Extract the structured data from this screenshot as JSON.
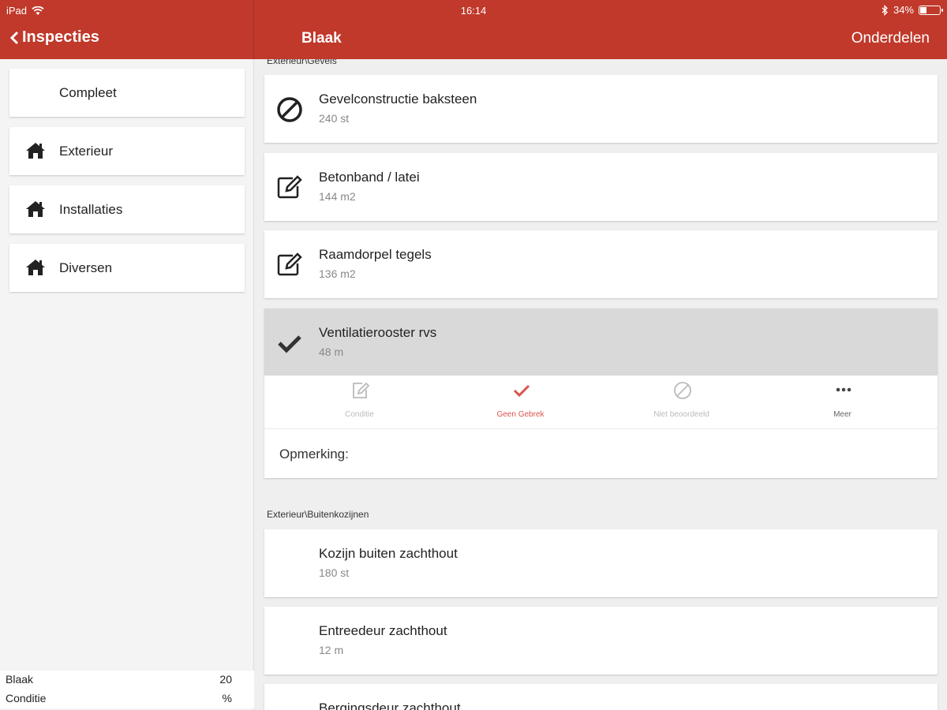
{
  "status_bar": {
    "device": "iPad",
    "time": "16:14",
    "battery": "34%",
    "battery_level": 0.34
  },
  "nav": {
    "back_label": "Inspecties",
    "title": "Blaak",
    "right_label": "Onderdelen"
  },
  "sidebar": {
    "items": [
      {
        "label": "Compleet",
        "icon": "none"
      },
      {
        "label": "Exterieur",
        "icon": "home-icon"
      },
      {
        "label": "Installaties",
        "icon": "home-icon"
      },
      {
        "label": "Diversen",
        "icon": "home-icon"
      }
    ],
    "stats": [
      {
        "label": "Blaak",
        "value": "20"
      },
      {
        "label": "Conditie",
        "value": "%"
      }
    ]
  },
  "main": {
    "section1_label": "Exterieur\\Gevels",
    "items1": [
      {
        "title": "Gevelconstructie baksteen",
        "sub": "240 st",
        "icon": "not-rated-icon"
      },
      {
        "title": "Betonband / latei",
        "sub": "144 m2",
        "icon": "edit-icon"
      },
      {
        "title": "Raamdorpel tegels",
        "sub": "136 m2",
        "icon": "edit-icon"
      },
      {
        "title": "Ventilatierooster rvs",
        "sub": "48 m",
        "icon": "check-icon"
      }
    ],
    "actions": [
      {
        "label": "Conditie",
        "icon": "edit-icon"
      },
      {
        "label": "Geen Gebrek",
        "icon": "check-icon"
      },
      {
        "label": "Niet beoordeeld",
        "icon": "not-rated-icon"
      },
      {
        "label": "Meer",
        "icon": "more-icon"
      }
    ],
    "remark_label": "Opmerking:",
    "section2_label": "Exterieur\\Buitenkozijnen",
    "items2": [
      {
        "title": "Kozijn buiten zachthout",
        "sub": "180 st"
      },
      {
        "title": "Entreedeur zachthout",
        "sub": "12 m"
      },
      {
        "title": "Bergingsdeur zachthout",
        "sub": ""
      }
    ]
  },
  "colors": {
    "accent": "#c0392b",
    "action_active": "#d9534f"
  }
}
